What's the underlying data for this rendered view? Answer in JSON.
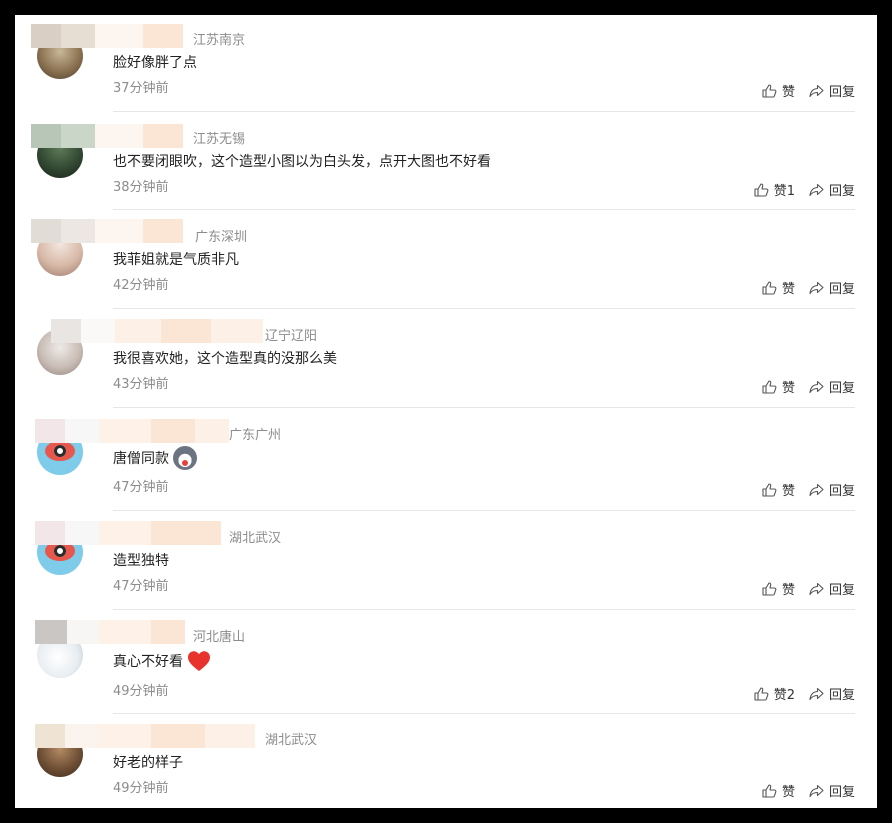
{
  "comments": [
    {
      "location": "江苏南京",
      "text": "脸好像胖了点",
      "time": "37分钟前",
      "like": "赞",
      "reply": "回复",
      "avatar": "photo",
      "emoji": ""
    },
    {
      "location": "江苏无锡",
      "text": "也不要闭眼吹，这个造型小图以为白头发，点开大图也不好看",
      "time": "38分钟前",
      "like": "赞1",
      "reply": "回复",
      "avatar": "green",
      "emoji": ""
    },
    {
      "location": "广东深圳",
      "text": "我菲姐就是气质非凡",
      "time": "42分钟前",
      "like": "赞",
      "reply": "回复",
      "avatar": "girl",
      "emoji": ""
    },
    {
      "location": "辽宁辽阳",
      "text": "我很喜欢她，这个造型真的没那么美",
      "time": "43分钟前",
      "like": "赞",
      "reply": "回复",
      "avatar": "sketch",
      "emoji": ""
    },
    {
      "location": "广东广州",
      "text": "唐僧同款",
      "time": "47分钟前",
      "like": "赞",
      "reply": "回复",
      "avatar": "eye",
      "emoji": "husky-emoji"
    },
    {
      "location": "湖北武汉",
      "text": "造型独特",
      "time": "47分钟前",
      "like": "赞",
      "reply": "回复",
      "avatar": "eye",
      "emoji": ""
    },
    {
      "location": "河北唐山",
      "text": "真心不好看",
      "time": "49分钟前",
      "like": "赞2",
      "reply": "回复",
      "avatar": "white",
      "emoji": "heart-emoji"
    },
    {
      "location": "湖北武汉",
      "text": "好老的样子",
      "time": "49分钟前",
      "like": "赞",
      "reply": "回复",
      "avatar": "brown",
      "emoji": ""
    }
  ]
}
